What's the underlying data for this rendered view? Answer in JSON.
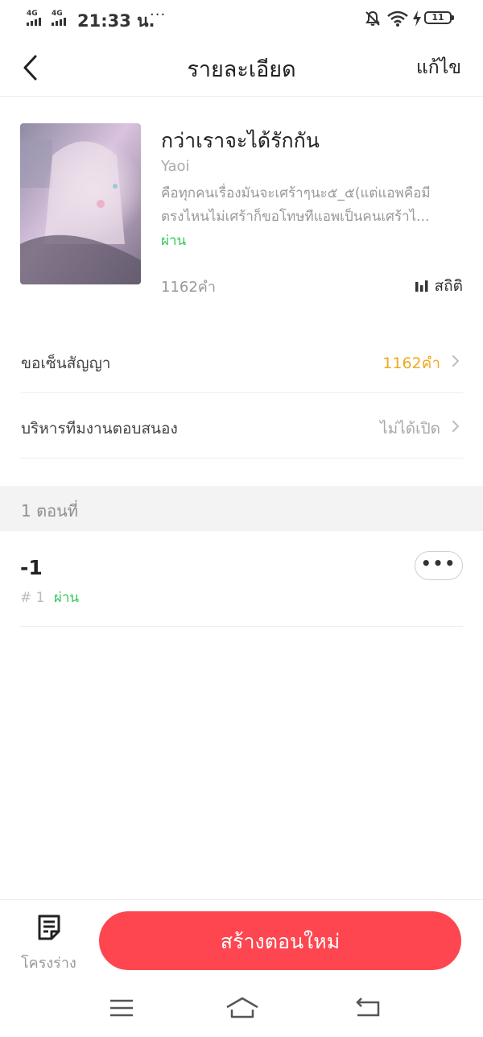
{
  "status_bar": {
    "signal_1": "4G",
    "signal_2": "4G",
    "time": "21:33 น.",
    "more": "···",
    "battery": "11",
    "icons": [
      "mute-bell-icon",
      "wifi-icon",
      "charging-icon",
      "battery-icon"
    ]
  },
  "header": {
    "title": "รายละเอียด",
    "edit_label": "แก้ไข",
    "back_icon": "back-chevron-icon"
  },
  "book": {
    "title": "กว่าเราจะได้รักกัน",
    "genre": "Yaoi",
    "description_line1": "คือทุกคนเรื่องมันจะเศร้าๆนะ๕_๕(แต่แอพคือมี",
    "description_line2": "ตรงไหนไม่เศร้าก็ขอโทษทีแอพเป็นคนเศร้าไ...",
    "status": "ผ่าน",
    "word_count": "1162คำ",
    "stats_label": "สถิติ",
    "stats_icon": "bar-chart-icon"
  },
  "rows": [
    {
      "label": "ขอเซ็นสัญญา",
      "value": "1162คำ",
      "value_color": "#f0a91e"
    },
    {
      "label": "บริหารทีมงานตอบสนอง",
      "value": "ไม่ได้เปิด",
      "value_color": "#a8a8a8"
    }
  ],
  "episodes_header": "1 ตอนที่",
  "episode": {
    "title": "-1",
    "number": "# 1",
    "status": "ผ่าน",
    "more_label": "•••"
  },
  "bottom": {
    "outline_label": "โครงร่าง",
    "outline_icon": "document-icon",
    "create_button": "สร้างตอนใหม่"
  },
  "nav_icons": [
    "menu-icon",
    "home-icon",
    "back-icon"
  ],
  "colors": {
    "accent": "#fd4650",
    "pass_green": "#34c759",
    "highlight": "#f0a91e"
  }
}
